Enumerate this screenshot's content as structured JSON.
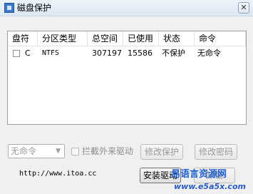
{
  "window": {
    "title": "磁盘保护",
    "close_glyph": "✕"
  },
  "table": {
    "columns": [
      "盘符",
      "分区类型",
      "总空间",
      "已使用",
      "状态",
      "命令"
    ],
    "rows": [
      {
        "drive": "C",
        "partition_type": "NTFS",
        "total": "307197",
        "used": "15586",
        "status": "不保护",
        "command": "无命令",
        "checked": false
      }
    ]
  },
  "controls": {
    "command_select_value": "无命令",
    "intercept_checkbox_label": "拦截外来驱动",
    "intercept_checked": false,
    "modify_protect_label": "修改保护",
    "modify_password_label": "修改密码",
    "install_driver_label": "安装驱动",
    "uninstall_label": "卸载"
  },
  "footer": {
    "url": "http://www.itoa.cc",
    "watermark_text": "易语言资源网",
    "watermark_url": "www.e5a5x.com"
  },
  "colors": {
    "watermark_blue": "#1e5fd0",
    "watermark_url_blue": "#2a5bbf"
  }
}
